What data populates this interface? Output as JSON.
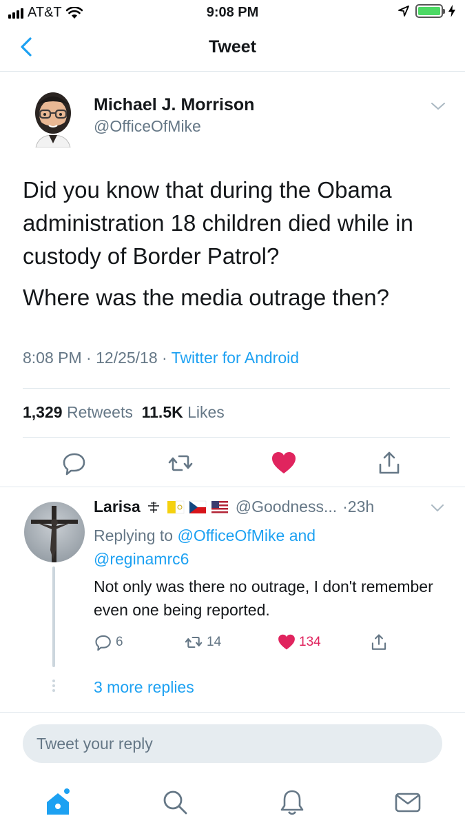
{
  "status_bar": {
    "carrier": "AT&T",
    "time": "9:08 PM",
    "battery_level": 1.0,
    "icons": [
      "signal-icon",
      "wifi-icon",
      "location-icon",
      "battery-icon",
      "charging-icon"
    ]
  },
  "nav": {
    "title": "Tweet",
    "back_icon": "chevron-left-icon"
  },
  "tweet": {
    "author_name": "Michael J. Morrison",
    "author_handle": "@OfficeOfMike",
    "text_p1": "Did you know that during the Obama administration 18 children died while in custody of Border Patrol?",
    "text_p2": "Where was the media outrage then?",
    "time": "8:08 PM",
    "date": "12/25/18",
    "source": "Twitter for Android",
    "retweets_count": "1,329",
    "retweets_label": "Retweets",
    "likes_count": "11.5K",
    "likes_label": "Likes"
  },
  "reply": {
    "name": "Larisa",
    "name_symbols": [
      "cross-icon",
      "vatican-flag-icon",
      "czech-flag-icon",
      "us-flag-icon"
    ],
    "handle": "@Goodness...",
    "time": "·23h",
    "replying_prefix": "Replying to",
    "replying_to_1": "@OfficeOfMike",
    "replying_and": "and",
    "replying_to_2": "@reginamrc6",
    "text": "Not only was there no outrage, I don't remember even one being reported.",
    "reply_count": "6",
    "retweet_count": "14",
    "like_count": "134",
    "more_replies": "3 more replies"
  },
  "compose": {
    "placeholder": "Tweet your reply"
  },
  "colors": {
    "accent": "#1da1f2",
    "like": "#e0245e",
    "muted": "#657786",
    "divider": "#e1e8ed"
  },
  "tabbar": [
    "home-icon",
    "search-icon",
    "notifications-icon",
    "messages-icon"
  ]
}
